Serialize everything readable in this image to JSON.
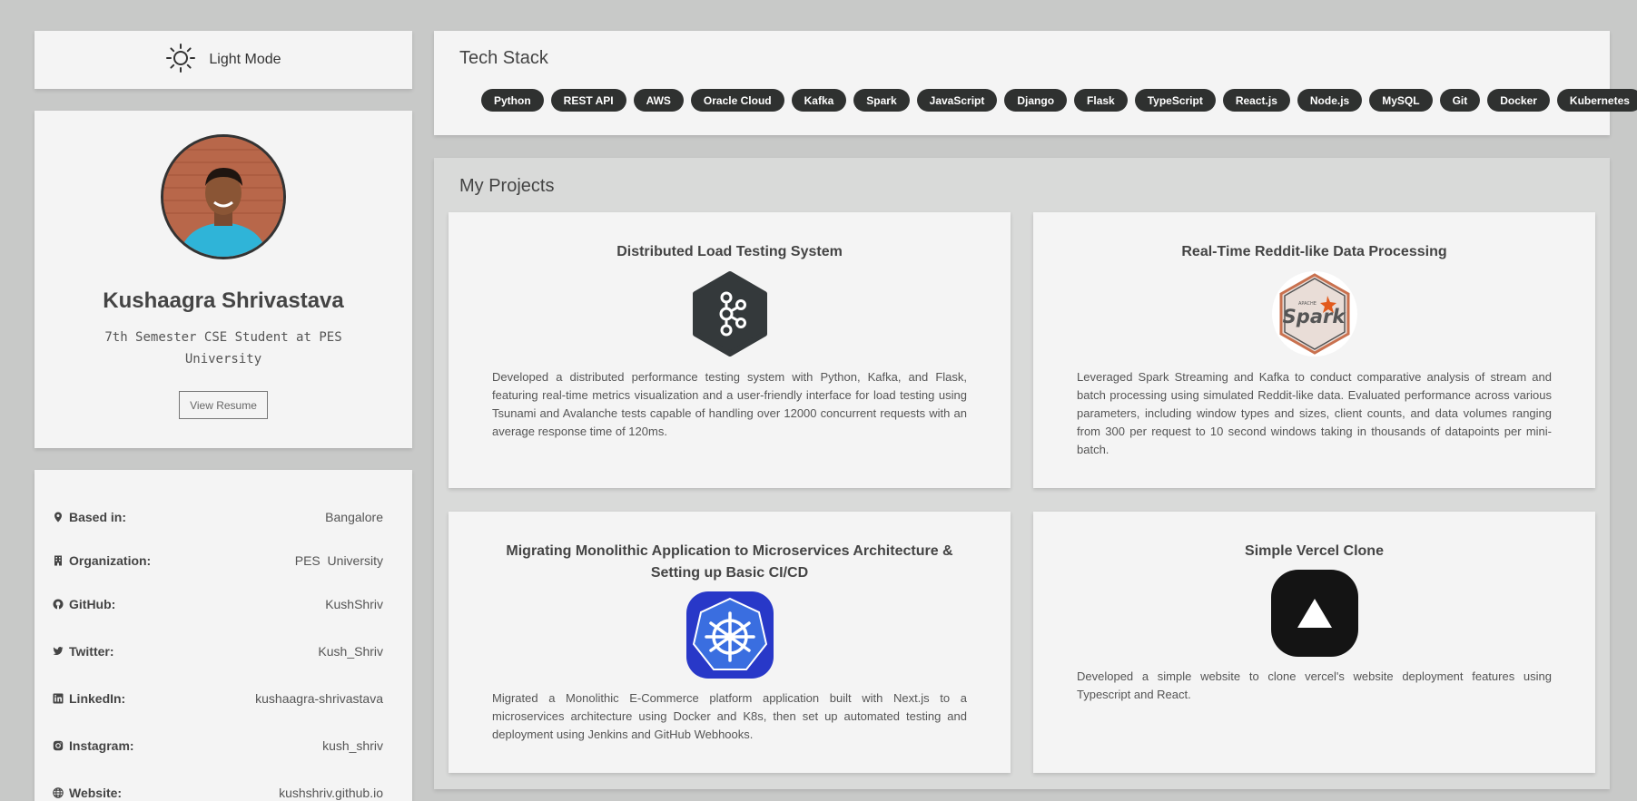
{
  "mode_toggle": {
    "label": "Light Mode",
    "icon": "sun-icon"
  },
  "profile": {
    "name": "Kushaagra Shrivastava",
    "subtitle": "7th Semester CSE Student at PES University",
    "resume_label": "View Resume"
  },
  "info": [
    {
      "icon": "location-pin-icon",
      "label": "Based in:",
      "value": "Bangalore"
    },
    {
      "icon": "building-icon",
      "label": "Organization:",
      "value": "PES  University"
    },
    {
      "icon": "github-icon",
      "label": "GitHub:",
      "value": "KushShriv"
    },
    {
      "icon": "twitter-icon",
      "label": "Twitter:",
      "value": "Kush_Shriv"
    },
    {
      "icon": "linkedin-icon",
      "label": "LinkedIn:",
      "value": "kushaagra-shrivastava"
    },
    {
      "icon": "instagram-icon",
      "label": "Instagram:",
      "value": "kush_shriv"
    },
    {
      "icon": "globe-icon",
      "label": "Website:",
      "value": "kushshriv.github.io"
    }
  ],
  "tech_stack": {
    "title": "Tech Stack",
    "tags": [
      "Python",
      "REST API",
      "AWS",
      "Oracle Cloud",
      "Kafka",
      "Spark",
      "JavaScript",
      "Django",
      "Flask",
      "TypeScript",
      "React.js",
      "Node.js",
      "MySQL",
      "Git",
      "Docker",
      "Kubernetes"
    ]
  },
  "projects": {
    "title": "My Projects",
    "items": [
      {
        "title": "Distributed Load Testing System",
        "logo": "kafka-logo-icon",
        "description": "Developed a distributed performance testing system with Python, Kafka, and Flask, featuring real-time metrics visualization and a user-friendly interface for load testing using Tsunami and Avalanche tests capable of handling over 12000 concurrent requests with an average response time of 120ms."
      },
      {
        "title": "Real-Time Reddit-like Data Processing",
        "logo": "spark-logo-icon",
        "logo_text": "Spark",
        "logo_small": "APACHE",
        "description": "Leveraged Spark Streaming and Kafka to conduct comparative analysis of stream and batch processing using simulated Reddit-like data. Evaluated performance across various parameters, including window types and sizes, client counts, and data volumes ranging from 300 per request to 10 second windows taking in thousands of datapoints per mini-batch."
      },
      {
        "title": "Migrating Monolithic Application to Microservices Architecture & Setting up Basic CI/CD",
        "logo": "kubernetes-logo-icon",
        "description": "Migrated a Monolithic E-Commerce platform application built with Next.js to a microservices architecture using Docker and K8s, then set up automated testing and deployment using Jenkins and GitHub Webhooks."
      },
      {
        "title": "Simple Vercel Clone",
        "logo": "vercel-logo-icon",
        "description": "Developed a simple website to clone vercel's website deployment features using Typescript and React."
      }
    ]
  }
}
